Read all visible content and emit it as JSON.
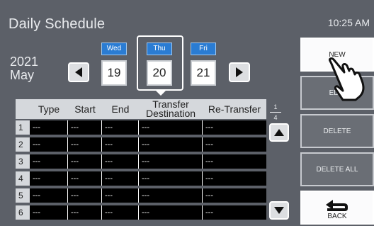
{
  "header": {
    "title": "Daily Schedule",
    "time": "10:25 AM"
  },
  "date": {
    "year": "2021",
    "month": "May"
  },
  "days": [
    {
      "weekday": "Wed",
      "day": "19"
    },
    {
      "weekday": "Thu",
      "day": "20",
      "selected": true
    },
    {
      "weekday": "Fri",
      "day": "21"
    }
  ],
  "table": {
    "columns": [
      "Type",
      "Start",
      "End",
      "Transfer Destination",
      "Re-Transfer"
    ],
    "rows": [
      {
        "num": "1",
        "cells": [
          "---",
          "---",
          "---",
          "---",
          "---"
        ]
      },
      {
        "num": "2",
        "cells": [
          "---",
          "---",
          "---",
          "---",
          "---"
        ]
      },
      {
        "num": "3",
        "cells": [
          "---",
          "---",
          "---",
          "---",
          "---"
        ]
      },
      {
        "num": "4",
        "cells": [
          "---",
          "---",
          "---",
          "---",
          "---"
        ]
      },
      {
        "num": "5",
        "cells": [
          "---",
          "---",
          "---",
          "---",
          "---"
        ]
      },
      {
        "num": "6",
        "cells": [
          "---",
          "---",
          "---",
          "---",
          "---"
        ]
      }
    ]
  },
  "pager": {
    "current": "1",
    "total": "4"
  },
  "actions": {
    "new": "NEW",
    "edit": "EDIT",
    "delete": "DELETE",
    "delete_all": "DELETE ALL",
    "back": "BACK"
  },
  "colors": {
    "background": "#5c6068",
    "accent": "#2a7cd3",
    "table_body": "#000000"
  },
  "icons": {
    "prev": "triangle-left-icon",
    "next": "triangle-right-icon",
    "up": "triangle-up-icon",
    "down": "triangle-down-icon",
    "back": "return-arrow-icon",
    "hand": "pointing-hand-icon"
  }
}
